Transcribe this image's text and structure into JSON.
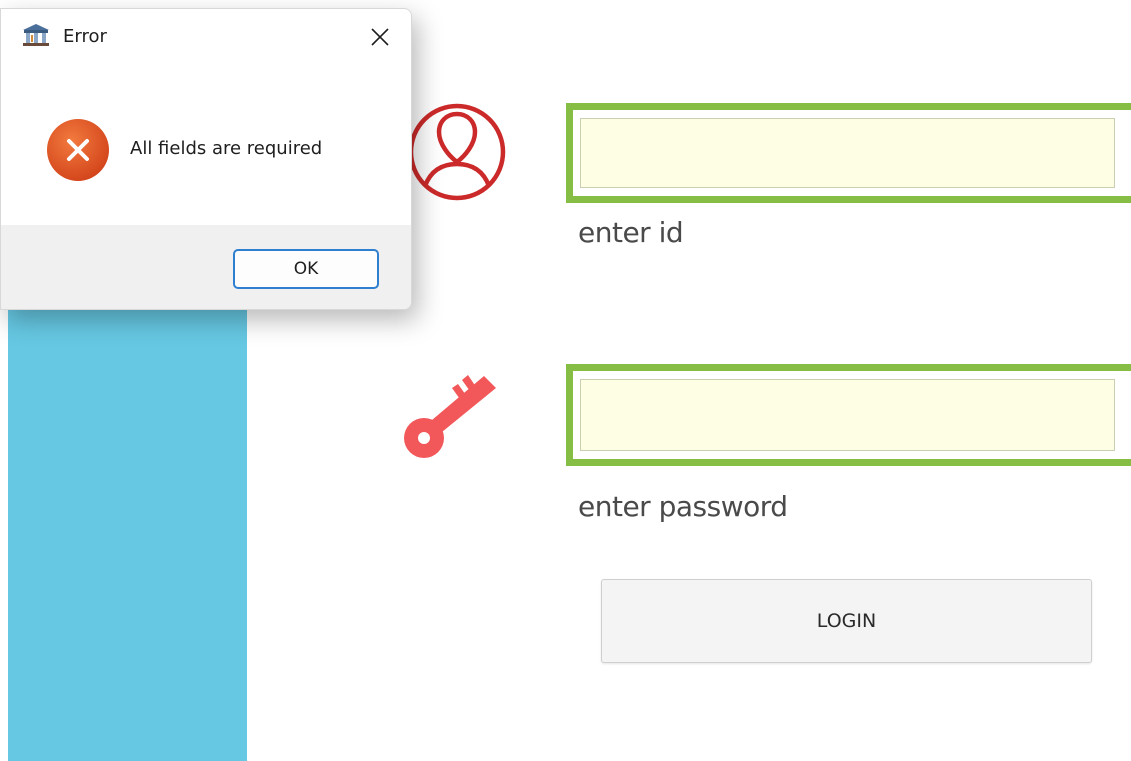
{
  "dialog": {
    "title": "Error",
    "message": "All fields are required",
    "ok_label": "OK",
    "icons": {
      "app": "bank-building-icon",
      "close": "close-icon",
      "status": "error-icon"
    },
    "error_color": "#e1501c"
  },
  "login_form": {
    "id_field": {
      "value": "",
      "label": "enter id",
      "icon": "user-icon"
    },
    "password_field": {
      "value": "",
      "label": "enter password",
      "icon": "key-icon"
    },
    "login_label": "LOGIN"
  },
  "colors": {
    "side_panel": "#66c8e3",
    "field_border": "#86bd45",
    "field_background": "#fefee4",
    "user_icon": "#cc2a2a",
    "key_icon": "#f2585a"
  }
}
